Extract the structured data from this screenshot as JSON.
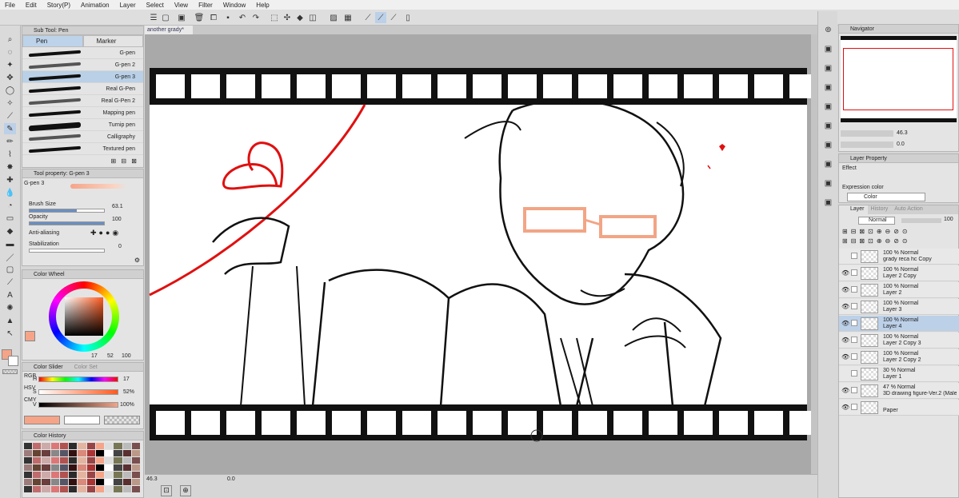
{
  "menu": [
    "File",
    "Edit",
    "Story(P)",
    "Animation",
    "Layer",
    "Select",
    "View",
    "Filter",
    "Window",
    "Help"
  ],
  "document_tab": "another grady*",
  "subtool": {
    "title": "Sub Tool: Pen",
    "tabs": [
      "Pen",
      "Marker"
    ],
    "brushes": [
      "G-pen",
      "G-pen 2",
      "G-pen 3",
      "Real G-Pen",
      "Real G-Pen 2",
      "Mapping pen",
      "Turnip pen",
      "Calligraphy",
      "Textured pen"
    ],
    "selected_index": 2
  },
  "toolprop": {
    "title": "Tool property: G-pen 3",
    "brush_name": "G-pen 3",
    "brush_size_label": "Brush Size",
    "brush_size_value": "63.1",
    "opacity_label": "Opacity",
    "opacity_value": "100",
    "antialias_label": "Anti-aliasing",
    "stabilization_label": "Stabilization",
    "stabilization_value": "0"
  },
  "colorwheel": {
    "title": "Color Wheel",
    "hsv_readout": [
      "17",
      "52",
      "100"
    ],
    "main_color": "#f5a488"
  },
  "colorslider": {
    "title": "Color Slider",
    "tab2": "Color Set",
    "values": [
      "17",
      "52%",
      "100%"
    ],
    "side_labels": [
      "RGB",
      "HSV",
      "CMY"
    ],
    "channel_labels": [
      "H",
      "S",
      "V"
    ]
  },
  "colorhistory": {
    "title": "Color History"
  },
  "canvas": {
    "line_color": "#e01010",
    "glasses_color": "#f2a585"
  },
  "status": {
    "zoom": "46.3",
    "angle": "0.0"
  },
  "navigator": {
    "title": "Navigator",
    "zoom": "46.3",
    "angle": "0.0"
  },
  "layerprop": {
    "title": "Layer Property",
    "effect_label": "Effect",
    "expression_label": "Expression color",
    "expression_value": "Color"
  },
  "layerpanel": {
    "tabs": [
      "Layer",
      "History",
      "Auto Action"
    ],
    "blend_mode": "Normal",
    "opacity": "100",
    "layers": [
      {
        "line1": "100 % Normal",
        "line2": "grady reca hc Copy",
        "visible": false
      },
      {
        "line1": "100 % Normal",
        "line2": "Layer 2 Copy",
        "visible": true
      },
      {
        "line1": "100 % Normal",
        "line2": "Layer 2",
        "visible": true
      },
      {
        "line1": "100 % Normal",
        "line2": "Layer 3",
        "visible": true
      },
      {
        "line1": "100 % Normal",
        "line2": "Layer 4",
        "visible": true
      },
      {
        "line1": "100 % Normal",
        "line2": "Layer 2 Copy 3",
        "visible": true
      },
      {
        "line1": "100 % Normal",
        "line2": "Layer 2 Copy 2",
        "visible": true
      },
      {
        "line1": "30 % Normal",
        "line2": "Layer 1",
        "visible": false
      },
      {
        "line1": "47 % Normal",
        "line2": "3D drawing figure-Ver.2 (Male)",
        "visible": true
      },
      {
        "line1": "",
        "line2": "Paper",
        "visible": true
      }
    ],
    "selected_index": 4
  }
}
